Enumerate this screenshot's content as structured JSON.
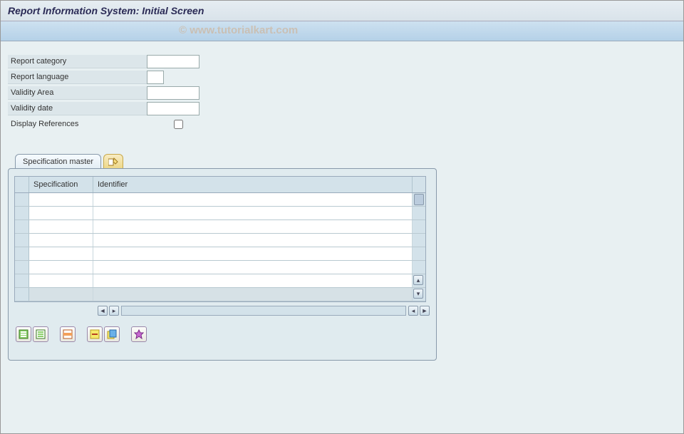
{
  "header": {
    "title": "Report Information System: Initial Screen"
  },
  "watermark": "© www.tutorialkart.com",
  "form": {
    "report_category": {
      "label": "Report category",
      "value": ""
    },
    "report_language": {
      "label": "Report language",
      "value": ""
    },
    "validity_area": {
      "label": "Validity Area",
      "value": ""
    },
    "validity_date": {
      "label": "Validity date",
      "value": ""
    },
    "display_references": {
      "label": "Display References",
      "checked": false
    }
  },
  "tab": {
    "spec_master": "Specification master"
  },
  "grid": {
    "columns": {
      "specification": "Specification",
      "identifier": "Identifier"
    },
    "rows": [
      {
        "specification": "",
        "identifier": "",
        "editable": true
      },
      {
        "specification": "",
        "identifier": "",
        "editable": true
      },
      {
        "specification": "",
        "identifier": "",
        "editable": true
      },
      {
        "specification": "",
        "identifier": "",
        "editable": true
      },
      {
        "specification": "",
        "identifier": "",
        "editable": true
      },
      {
        "specification": "",
        "identifier": "",
        "editable": true
      },
      {
        "specification": "",
        "identifier": "",
        "editable": true
      },
      {
        "specification": "",
        "identifier": "",
        "editable": false
      }
    ]
  },
  "icons": {
    "tab_action": "display-change-icon",
    "toolbar": [
      "select-all",
      "deselect-all",
      "insert-row",
      "delete-row",
      "copy-row",
      "configure"
    ]
  }
}
